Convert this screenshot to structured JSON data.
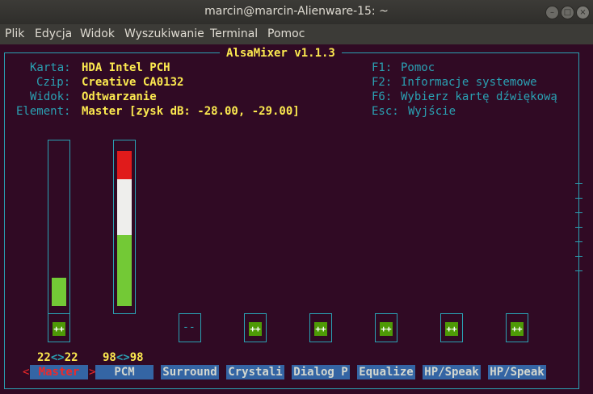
{
  "window": {
    "title": "marcin@marcin-Alienware-15: ~",
    "btn_minimize": "–",
    "btn_maximize": "□",
    "btn_close": "×"
  },
  "menu": [
    "Plik",
    "Edycja",
    "Widok",
    "Wyszukiwanie",
    "Terminal",
    "Pomoc"
  ],
  "app": {
    "title": "AlsaMixer v1.1.3"
  },
  "info": {
    "karta_label": "Karta:",
    "karta_value": "HDA Intel PCH",
    "czip_label": "Czip:",
    "czip_value": "Creative CA0132",
    "widok_label": "Widok:",
    "widok_value": "Odtwarzanie",
    "element_label": "Element:",
    "element_value": "Master [zysk dB: -28.00, -29.00]"
  },
  "help": [
    {
      "key": "F1:",
      "text": "Pomoc"
    },
    {
      "key": "F2:",
      "text": "Informacje systemowe"
    },
    {
      "key": "F6:",
      "text": "Wybierz kartę dźwiękową"
    },
    {
      "key": "Esc:",
      "text": "Wyjście"
    }
  ],
  "controls": [
    {
      "name": "Master",
      "left": "22",
      "sep": "<>",
      "right": "22",
      "level": 0.22,
      "selected": true,
      "capture": "++"
    },
    {
      "name": "PCM",
      "left": "98",
      "sep": "<>",
      "right": "98",
      "level": 0.98,
      "selected": false,
      "capture": ""
    },
    {
      "name": "Surround",
      "capture": "--"
    },
    {
      "name": "Crystali",
      "capture": "++"
    },
    {
      "name": "Dialog P",
      "capture": "++"
    },
    {
      "name": "Equalize",
      "capture": "++"
    },
    {
      "name": "HP/Speak",
      "capture": "++"
    },
    {
      "name": "HP/Speak",
      "capture": "++"
    }
  ],
  "selector": {
    "left": "<",
    "right": ">"
  },
  "colors": {
    "bg": "#300a24",
    "cyan": "#2aa1b3",
    "yellow": "#fce94f",
    "green": "#73c936",
    "white": "#eeeeec",
    "red": "#e01b1b",
    "label_bg": "#3465a4",
    "selected_fg": "#ef2929"
  }
}
